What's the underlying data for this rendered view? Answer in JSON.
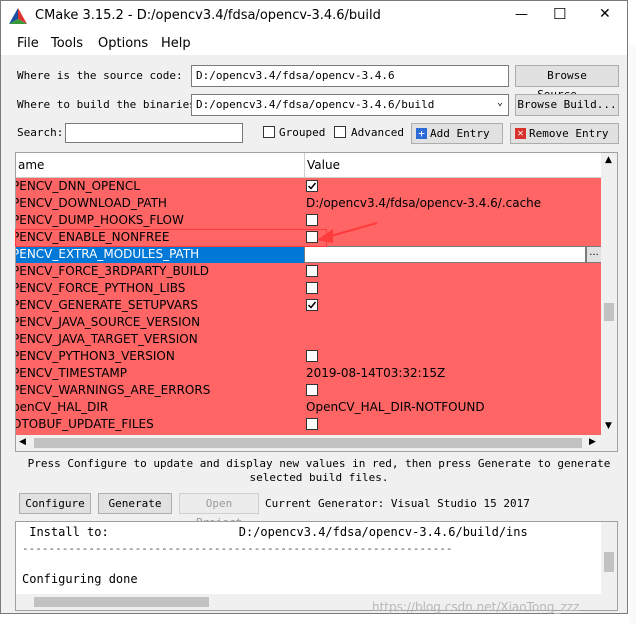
{
  "window": {
    "title": "CMake 3.15.2 - D:/opencv3.4/fdsa/opencv-3.4.6/build",
    "minimize_glyph": "—",
    "maximize_glyph": "☐",
    "close_glyph": "✕"
  },
  "menu": {
    "file": "File",
    "tools": "Tools",
    "options": "Options",
    "help": "Help"
  },
  "source": {
    "label": "Where is the source code:",
    "value": "D:/opencv3.4/fdsa/opencv-3.4.6",
    "browse": "Browse Source..."
  },
  "build": {
    "label": "Where to build the binaries:",
    "value": "D:/opencv3.4/fdsa/opencv-3.4.6/build",
    "browse": "Browse Build..."
  },
  "search": {
    "label": "Search:",
    "value": "",
    "grouped": "Grouped",
    "advanced": "Advanced",
    "add_entry": "Add Entry",
    "remove_entry": "Remove Entry"
  },
  "grid": {
    "col_name": "ame",
    "col_value": "Value",
    "rows": [
      {
        "name": "PENCV_DNN_OPENCL",
        "type": "bool",
        "checked": true
      },
      {
        "name": "PENCV_DOWNLOAD_PATH",
        "type": "text",
        "value": "D:/opencv3.4/fdsa/opencv-3.4.6/.cache"
      },
      {
        "name": "PENCV_DUMP_HOOKS_FLOW",
        "type": "bool",
        "checked": false
      },
      {
        "name": "PENCV_ENABLE_NONFREE",
        "type": "bool",
        "checked": false
      },
      {
        "name": "PENCV_EXTRA_MODULES_PATH",
        "type": "edit",
        "value": ""
      },
      {
        "name": "PENCV_FORCE_3RDPARTY_BUILD",
        "type": "bool",
        "checked": false
      },
      {
        "name": "PENCV_FORCE_PYTHON_LIBS",
        "type": "bool",
        "checked": false
      },
      {
        "name": "PENCV_GENERATE_SETUPVARS",
        "type": "bool",
        "checked": true
      },
      {
        "name": "PENCV_JAVA_SOURCE_VERSION",
        "type": "text",
        "value": ""
      },
      {
        "name": "PENCV_JAVA_TARGET_VERSION",
        "type": "text",
        "value": ""
      },
      {
        "name": "PENCV_PYTHON3_VERSION",
        "type": "bool",
        "checked": false
      },
      {
        "name": "PENCV_TIMESTAMP",
        "type": "text",
        "value": "2019-08-14T03:32:15Z"
      },
      {
        "name": "PENCV_WARNINGS_ARE_ERRORS",
        "type": "bool",
        "checked": false
      },
      {
        "name": "penCV_HAL_DIR",
        "type": "text",
        "value": "OpenCV_HAL_DIR-NOTFOUND"
      },
      {
        "name": "OTOBUF_UPDATE_FILES",
        "type": "bool",
        "checked": false
      }
    ],
    "browse_dots": "..."
  },
  "hint": "Press Configure to update and display new values in red, then press Generate to generate selected build files.",
  "actions": {
    "configure": "Configure",
    "generate": "Generate",
    "open_project": "Open Project",
    "generator": "Current Generator: Visual Studio 15 2017"
  },
  "output": {
    "line1": " Install to:                  D:/opencv3.4/fdsa/opencv-3.4.6/build/ins",
    "line2": "-----------------------------------------------------------------",
    "line3": "Configuring done"
  },
  "watermark": "https://blog.csdn.net/XiaoTong_zzz",
  "colors": {
    "changed_row": "#ff6565",
    "selection": "#0078d7",
    "annotation": "#ff3b3b"
  }
}
